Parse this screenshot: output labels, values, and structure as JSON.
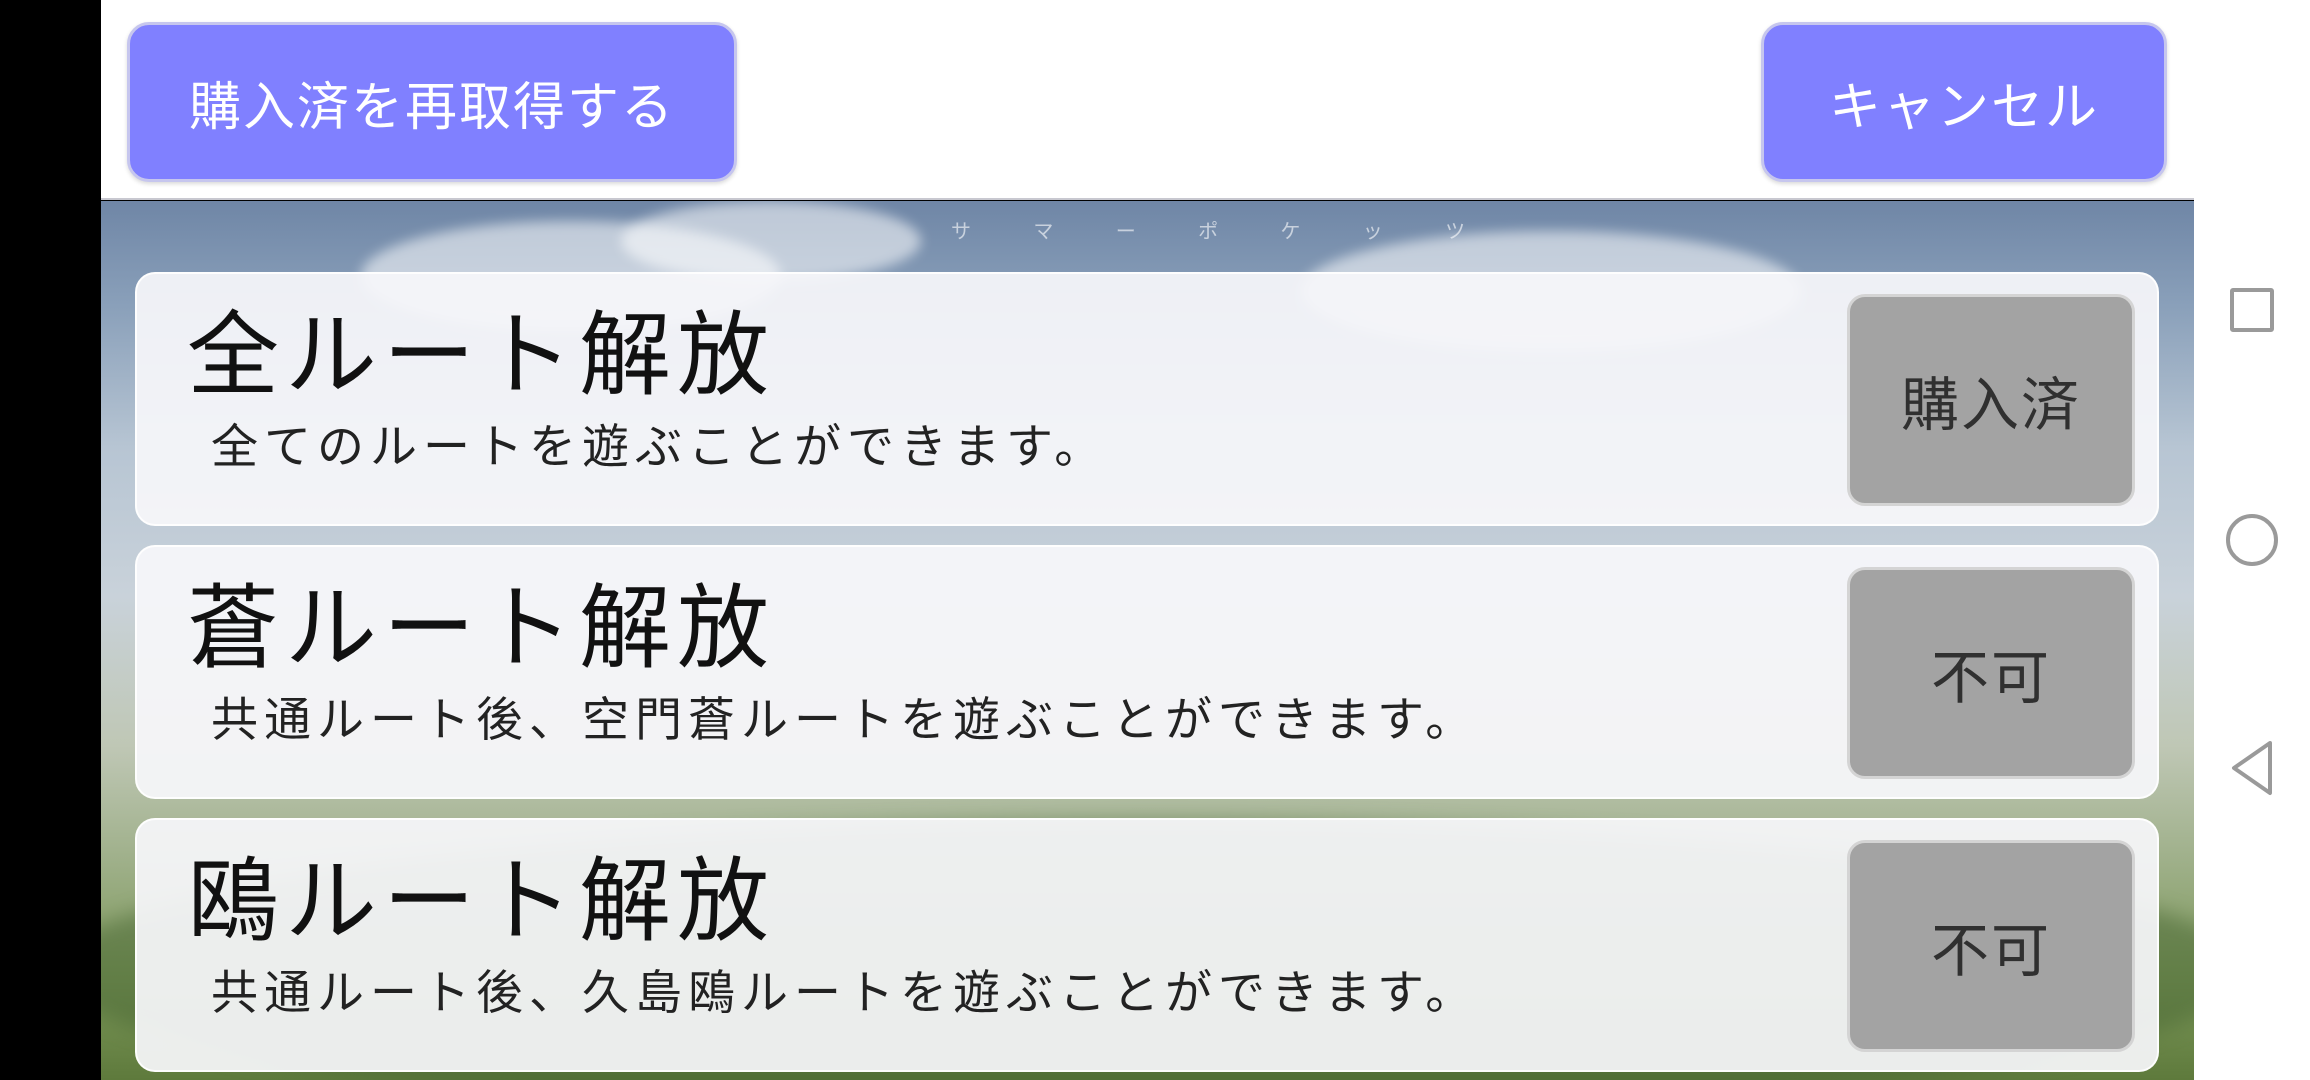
{
  "header": {
    "restore_label": "購入済を再取得する",
    "cancel_label": "キャンセル"
  },
  "background": {
    "logo_text": "サ マ ー ポ ケ ッ ツ"
  },
  "items": [
    {
      "title": "全ルート解放",
      "description": "全てのルートを遊ぶことができます。",
      "status": "購入済"
    },
    {
      "title": "蒼ルート解放",
      "description": "共通ルート後、空門蒼ルートを遊ぶことができます。",
      "status": "不可"
    },
    {
      "title": "鴎ルート解放",
      "description": "共通ルート後、久島鴎ルートを遊ぶことができます。",
      "status": "不可"
    }
  ],
  "nav": {
    "icons": [
      "recent-apps-icon",
      "home-icon",
      "back-icon"
    ]
  },
  "colors": {
    "header_button": "#8080ff",
    "status_button": "#a3a3a3"
  }
}
